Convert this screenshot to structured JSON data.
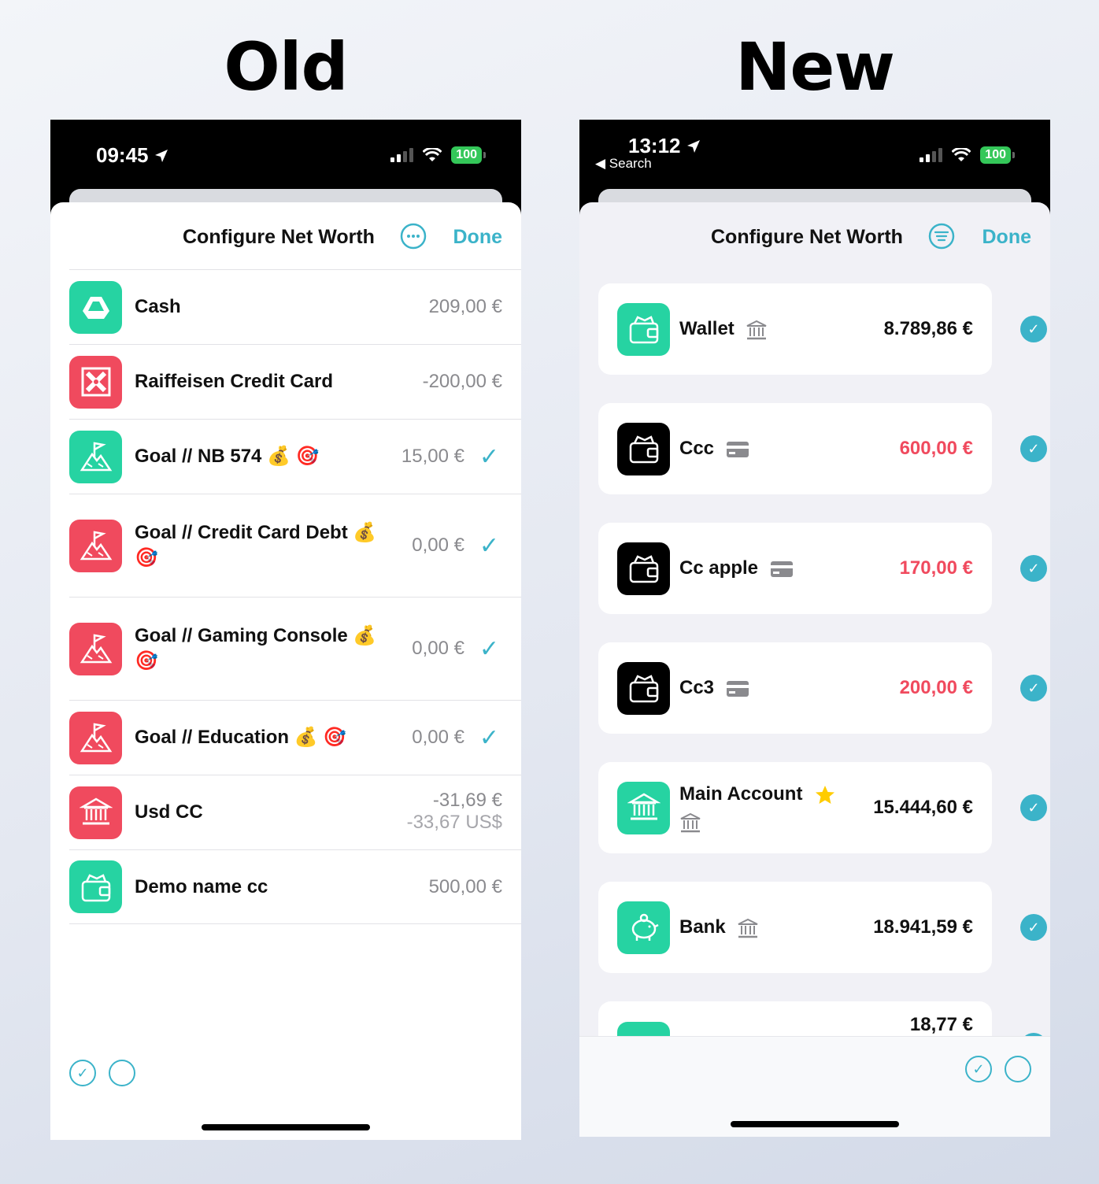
{
  "headings": {
    "old": "Old",
    "new": "New"
  },
  "old": {
    "status": {
      "time": "09:45",
      "battery": "100"
    },
    "nav": {
      "title": "Configure Net Worth",
      "done": "Done"
    },
    "rows": [
      {
        "name": "Cash",
        "amount": "209,00 €",
        "sub": "",
        "checked": false,
        "color": "#26d3a2",
        "icon": "drive-icon"
      },
      {
        "name": "Raiffeisen Credit Card",
        "amount": "-200,00 €",
        "sub": "",
        "checked": false,
        "color": "#f04a5e",
        "icon": "raiffeisen-icon"
      },
      {
        "name": "Goal // NB 574 💰 🎯",
        "amount": "15,00 €",
        "sub": "",
        "checked": true,
        "color": "#26d3a2",
        "icon": "mountain-flag-icon"
      },
      {
        "name": "Goal // Credit Card Debt 💰 🎯",
        "amount": "0,00 €",
        "sub": "",
        "checked": true,
        "color": "#f04a5e",
        "icon": "mountain-flag-icon"
      },
      {
        "name": "Goal // Gaming Console 💰 🎯",
        "amount": "0,00 €",
        "sub": "",
        "checked": true,
        "color": "#f04a5e",
        "icon": "mountain-flag-icon"
      },
      {
        "name": "Goal // Education 💰 🎯",
        "amount": "0,00 €",
        "sub": "",
        "checked": true,
        "color": "#f04a5e",
        "icon": "mountain-flag-icon"
      },
      {
        "name": "Usd CC",
        "amount": "-31,69 €",
        "sub": "-33,67 US$",
        "checked": false,
        "color": "#f04a5e",
        "icon": "bank-icon"
      },
      {
        "name": "Demo name cc",
        "amount": "500,00 €",
        "sub": "",
        "checked": false,
        "color": "#26d3a2",
        "icon": "wallet-icon"
      }
    ]
  },
  "new": {
    "status": {
      "time": "13:12",
      "back": "◀ Search",
      "battery": "100"
    },
    "nav": {
      "title": "Configure Net Worth",
      "done": "Done"
    },
    "cards": [
      {
        "name": "Wallet",
        "tag": "bank-tag-icon",
        "amount": "8.789,86 €",
        "negative": false,
        "color": "#26d3a2",
        "icon": "wallet-icon"
      },
      {
        "name": "Ccc",
        "tag": "card-tag-icon",
        "amount": "600,00 €",
        "negative": true,
        "color": "#000000",
        "icon": "wallet-icon"
      },
      {
        "name": "Cc apple",
        "tag": "card-tag-icon",
        "amount": "170,00 €",
        "negative": true,
        "color": "#000000",
        "icon": "wallet-icon"
      },
      {
        "name": "Cc3",
        "tag": "card-tag-icon",
        "amount": "200,00 €",
        "negative": true,
        "color": "#000000",
        "icon": "wallet-icon"
      },
      {
        "name": "Main Account",
        "tag": "star-icon",
        "amount": "15.444,60 €",
        "negative": false,
        "color": "#26d3a2",
        "icon": "bank-icon"
      },
      {
        "name": "Bank",
        "tag": "bank-tag-icon",
        "amount": "18.941,59 €",
        "negative": false,
        "color": "#26d3a2",
        "icon": "piggy-bank-icon"
      },
      {
        "name": "",
        "tag": "",
        "amount": "18,77 €",
        "negative": false,
        "color": "#26d3a2",
        "icon": "plane-icon"
      }
    ]
  }
}
